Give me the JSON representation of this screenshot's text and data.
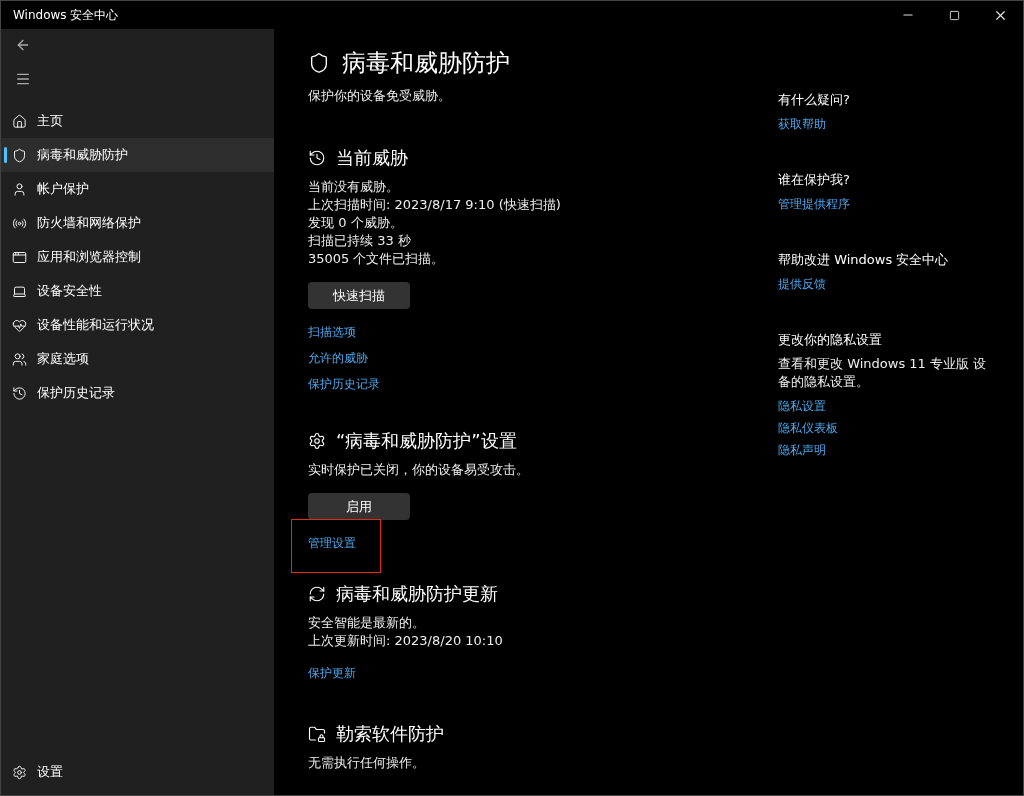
{
  "window": {
    "title": "Windows 安全中心"
  },
  "sidebar": {
    "items": [
      {
        "label": "主页",
        "kind": "home",
        "selected": false
      },
      {
        "label": "病毒和威胁防护",
        "kind": "shield",
        "selected": true
      },
      {
        "label": "帐户保护",
        "kind": "account",
        "selected": false
      },
      {
        "label": "防火墙和网络保护",
        "kind": "network",
        "selected": false
      },
      {
        "label": "应用和浏览器控制",
        "kind": "app",
        "selected": false
      },
      {
        "label": "设备安全性",
        "kind": "device",
        "selected": false
      },
      {
        "label": "设备性能和运行状况",
        "kind": "health",
        "selected": false
      },
      {
        "label": "家庭选项",
        "kind": "family",
        "selected": false
      },
      {
        "label": "保护历史记录",
        "kind": "history",
        "selected": false
      }
    ],
    "settings": "设置"
  },
  "page": {
    "title": "病毒和威胁防护",
    "subtitle": "保护你的设备免受威胁。"
  },
  "sections": [
    {
      "kind": "threats",
      "title": "当前威胁",
      "lines": [
        "当前没有威胁。",
        "上次扫描时间: 2023/8/17 9:10 (快速扫描)",
        "发现 0 个威胁。",
        "扫描已持续 33 秒",
        "35005 个文件已扫描。"
      ],
      "button": "快速扫描",
      "links": [
        {
          "label": "扫描选项"
        },
        {
          "label": "允许的威胁"
        },
        {
          "label": "保护历史记录"
        }
      ]
    },
    {
      "kind": "settings",
      "title": "“病毒和威胁防护”设置",
      "lines": [
        "实时保护已关闭，你的设备易受攻击。"
      ],
      "button": "启用",
      "links": [
        {
          "label": "管理设置",
          "highlighted": true
        }
      ]
    },
    {
      "kind": "updates",
      "title": "病毒和威胁防护更新",
      "lines": [
        "安全智能是最新的。",
        "上次更新时间: 2023/8/20 10:10"
      ],
      "links": [
        {
          "label": "保护更新"
        }
      ]
    },
    {
      "kind": "ransomware",
      "title": "勒索软件防护",
      "lines": [
        "无需执行任何操作。"
      ]
    }
  ],
  "aside": [
    {
      "title": "有什么疑问?",
      "links": [
        "获取帮助"
      ]
    },
    {
      "title": "谁在保护我?",
      "links": [
        "管理提供程序"
      ]
    },
    {
      "title": "帮助改进 Windows 安全中心",
      "links": [
        "提供反馈"
      ]
    },
    {
      "title": "更改你的隐私设置",
      "text": "查看和更改 Windows 11 专业版 设备的隐私设置。",
      "links": [
        "隐私设置",
        "隐私仪表板",
        "隐私声明"
      ]
    }
  ]
}
